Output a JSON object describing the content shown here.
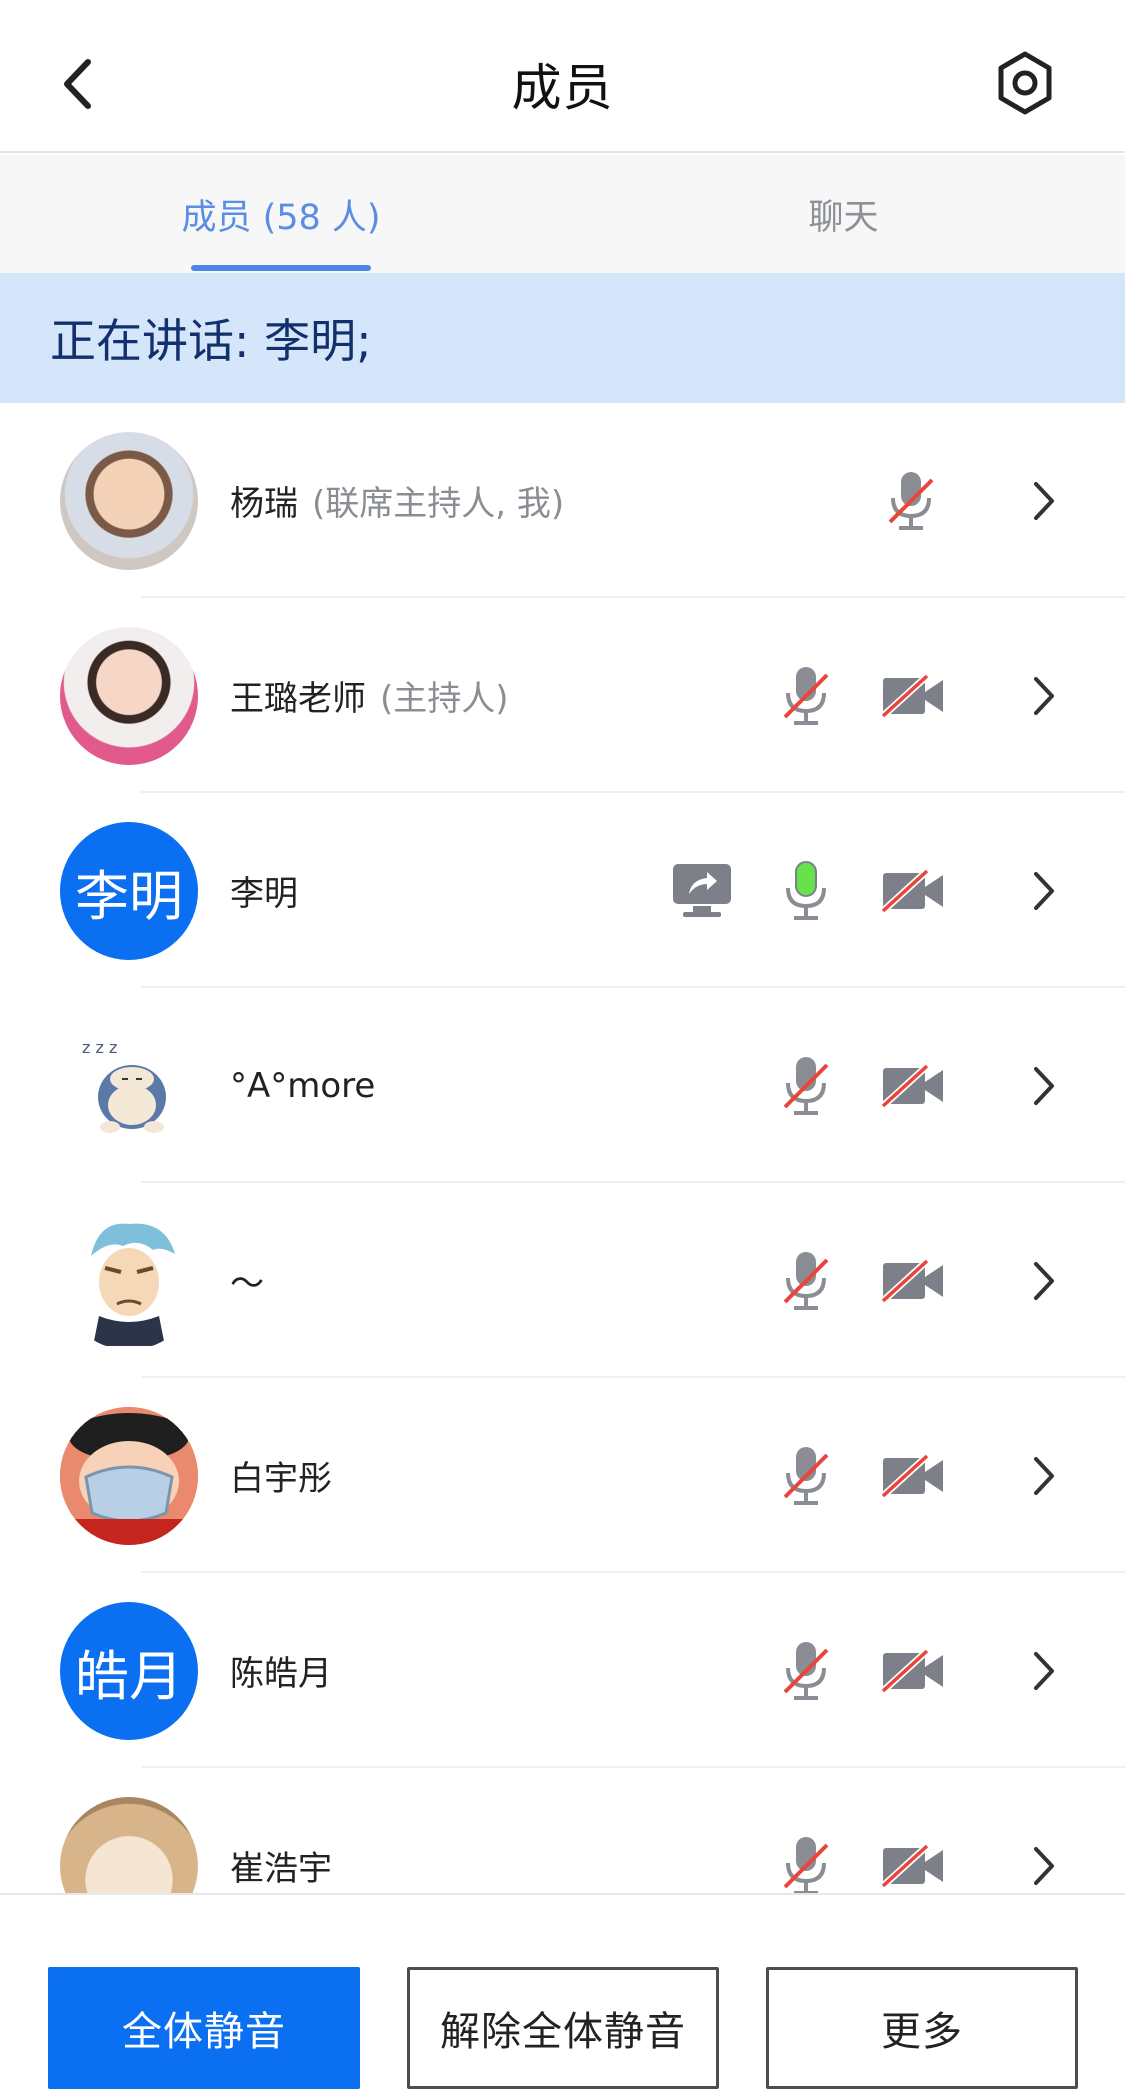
{
  "header": {
    "title": "成员"
  },
  "tabs": [
    {
      "label": "成员 (58 人)",
      "active": true
    },
    {
      "label": "聊天",
      "active": false
    }
  ],
  "speaking": {
    "text": "正在讲话: 李明;"
  },
  "members": [
    {
      "name": "杨瑞",
      "role": "(联席主持人, 我)",
      "avatar": "photo",
      "mic": "muted",
      "camera": "none",
      "sharing": false
    },
    {
      "name": "王璐老师",
      "role": "(主持人)",
      "avatar": "photo",
      "mic": "muted",
      "camera": "off",
      "sharing": false
    },
    {
      "name": "李明",
      "role": "",
      "avatar_text": "李明",
      "mic": "active",
      "camera": "off",
      "sharing": true
    },
    {
      "name": "°A°more",
      "role": "",
      "avatar": "cartoon",
      "mic": "muted",
      "camera": "off",
      "sharing": false
    },
    {
      "name": "～",
      "role": "",
      "avatar": "cartoon",
      "mic": "muted",
      "camera": "off",
      "sharing": false
    },
    {
      "name": "白宇彤",
      "role": "",
      "avatar": "cartoon",
      "mic": "muted",
      "camera": "off",
      "sharing": false
    },
    {
      "name": "陈皓月",
      "role": "",
      "avatar_text": "皓月",
      "mic": "muted",
      "camera": "off",
      "sharing": false
    },
    {
      "name": "崔浩宇",
      "role": "",
      "avatar": "photo",
      "mic": "muted",
      "camera": "off",
      "sharing": false
    }
  ],
  "footer": {
    "mute_all": "全体静音",
    "unmute_all": "解除全体静音",
    "more": "更多"
  },
  "colors": {
    "accent": "#0a6ff0",
    "tab_active": "#5a8de3",
    "banner_bg": "#d5e6fb",
    "mute_slash": "#e8453c",
    "mic_active": "#66e34a",
    "icon_gray": "#7d8089"
  }
}
